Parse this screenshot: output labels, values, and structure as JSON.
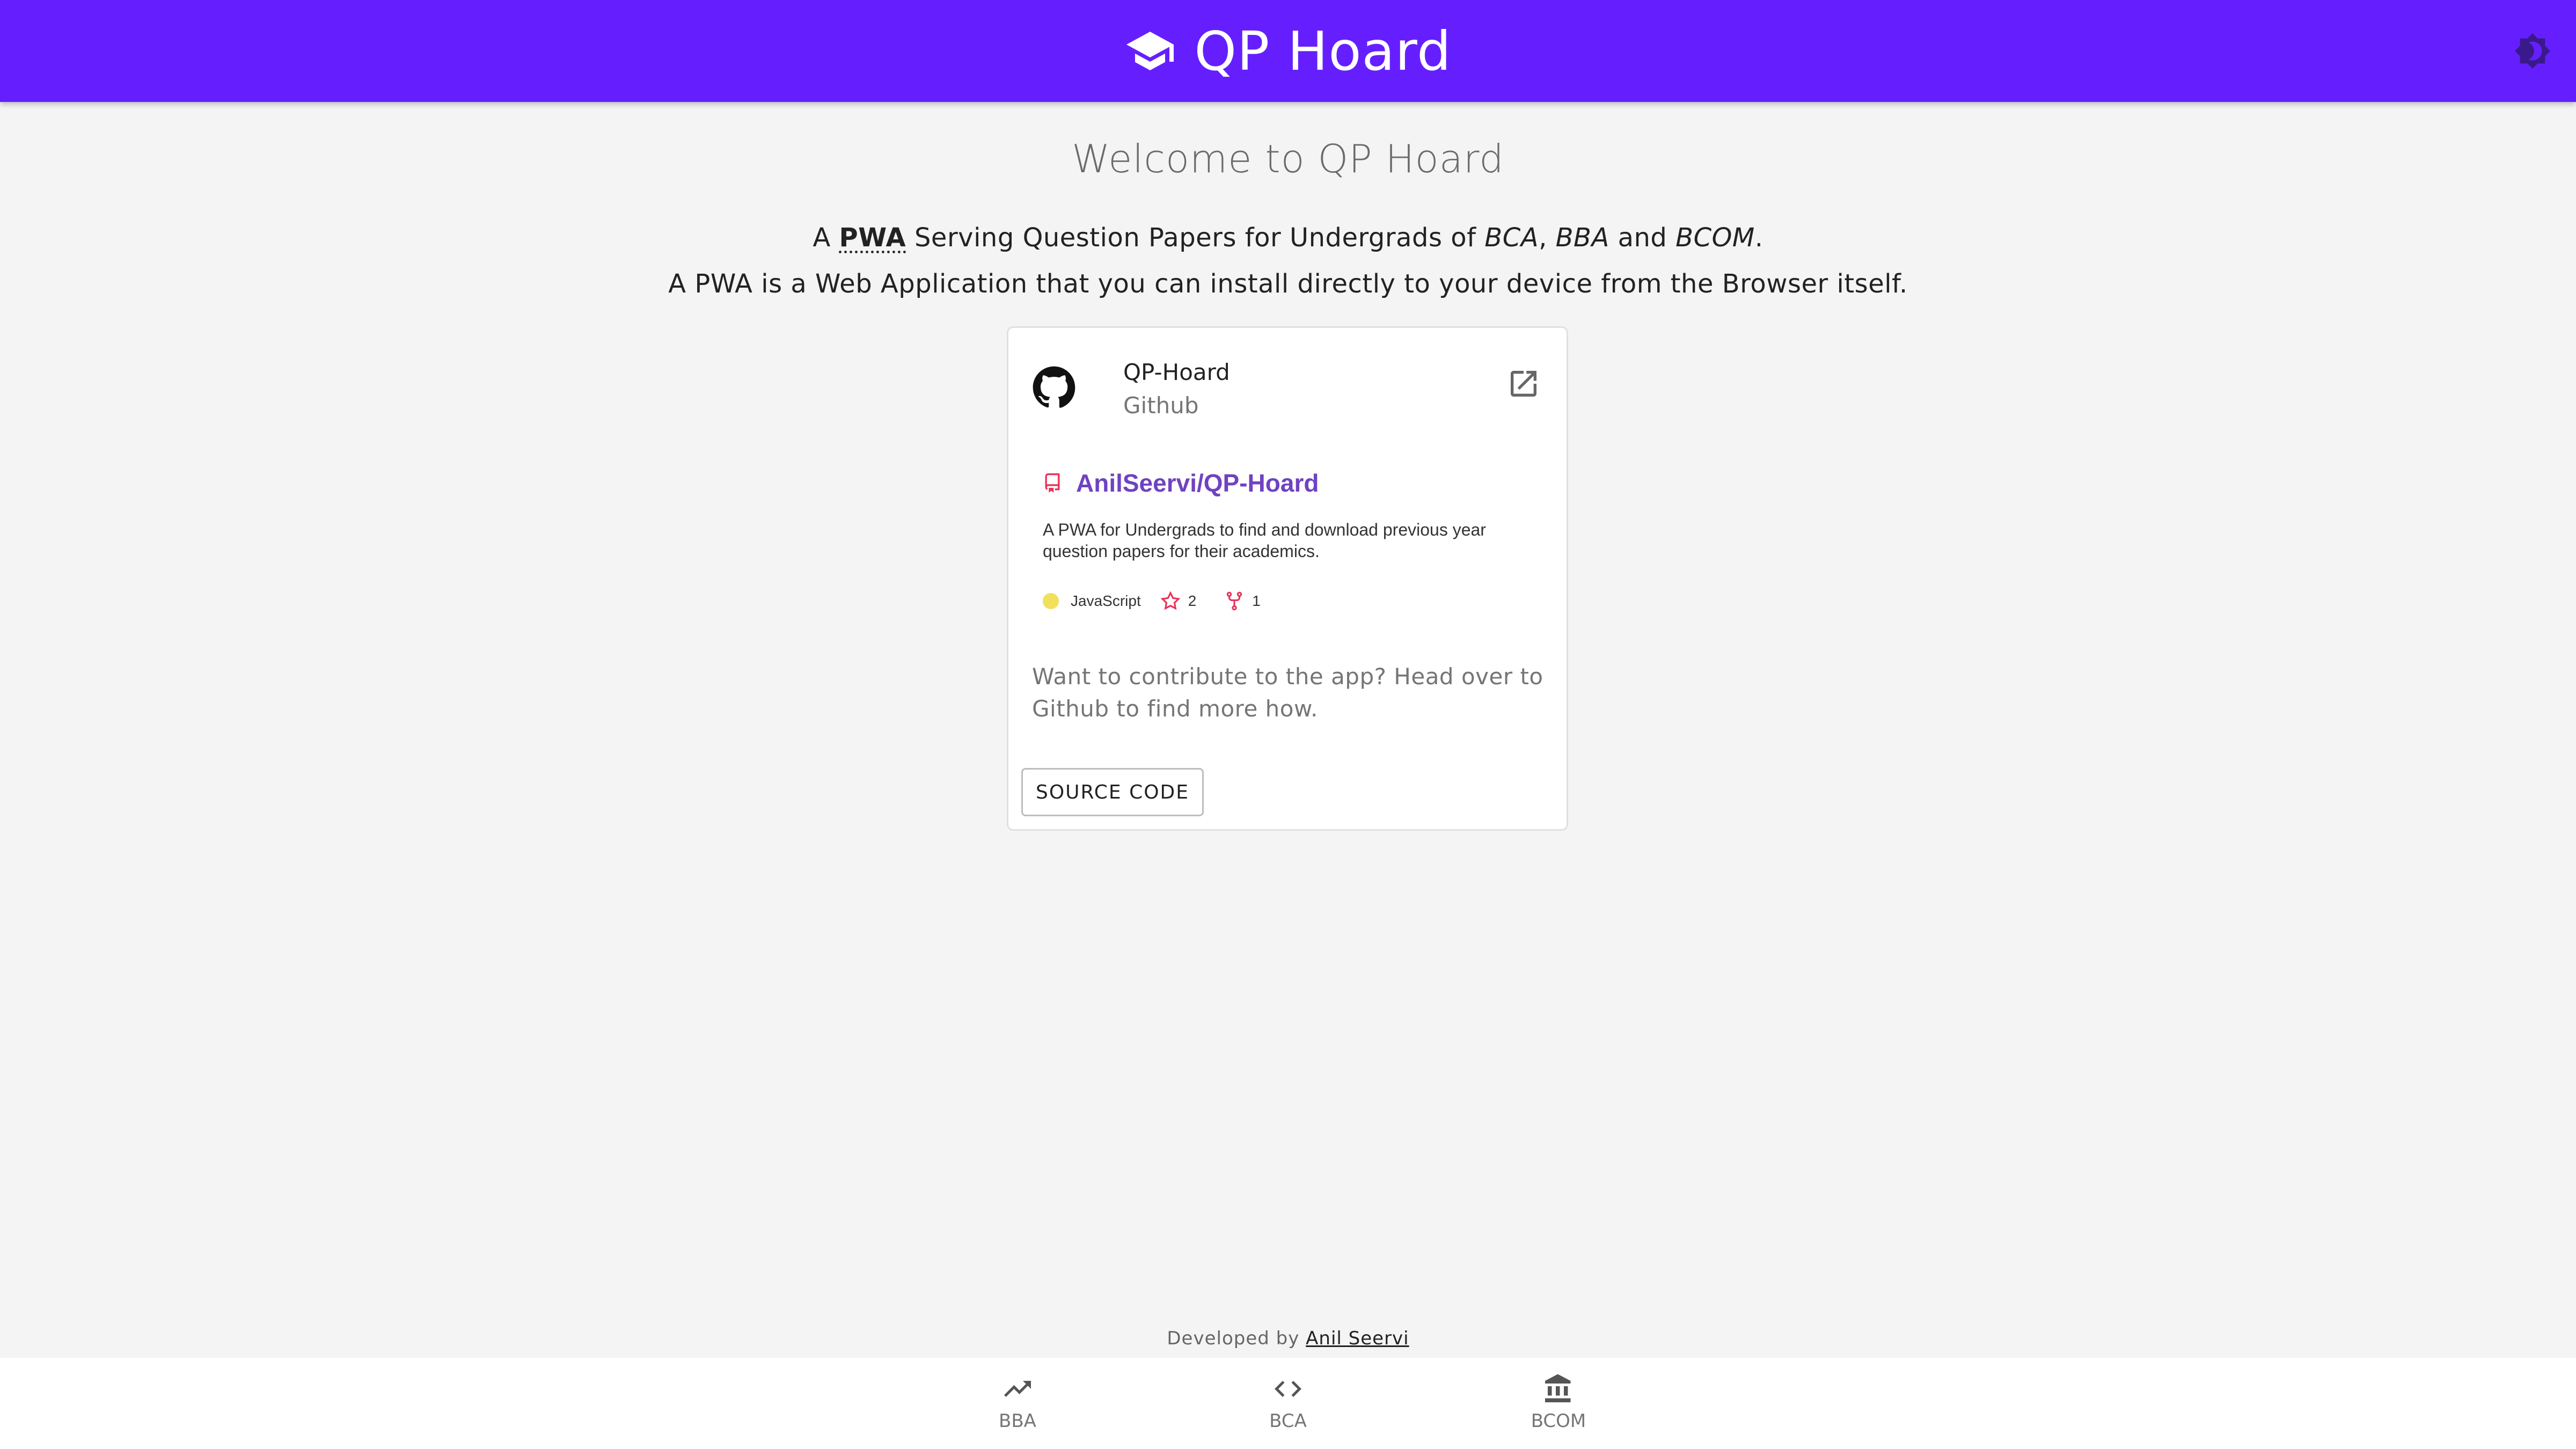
{
  "header": {
    "title": "QP Hoard",
    "logo_icon": "graduation-cap-icon",
    "theme_toggle_icon": "brightness-icon",
    "color": "#651fff"
  },
  "main": {
    "welcome": "Welcome to QP Hoard",
    "intro_line1": {
      "a": "A",
      "pwa": "PWA",
      "serving": "Serving Question Papers for Undergrads of",
      "bca": "BCA",
      "comma": ",",
      "bba": "BBA",
      "and": "and",
      "bcom": "BCOM",
      "period": "."
    },
    "intro_line2": "A PWA is a Web Application that you can install directly to your device from the Browser itself."
  },
  "card": {
    "title": "QP-Hoard",
    "subtitle": "Github",
    "avatar_icon": "github-icon",
    "open_icon": "open-in-new-icon",
    "repo": {
      "icon": "repo-icon",
      "name": "AnilSeervi/QP-Hoard",
      "description": "A PWA for Undergrads to find and download previous year question papers for their academics.",
      "language": "JavaScript",
      "language_color": "#f1e05a",
      "stars": "2",
      "forks": "1",
      "accent_color": "#e8335a"
    },
    "contribute_text": "Want to contribute to the app? Head over to Github to find more how.",
    "button_label": "SOURCE CODE"
  },
  "footer": {
    "developed_by": "Developed by",
    "author": "Anil Seervi"
  },
  "bottom_nav": [
    {
      "label": "BBA",
      "icon": "trending-up-icon"
    },
    {
      "label": "BCA",
      "icon": "code-icon"
    },
    {
      "label": "BCOM",
      "icon": "bank-icon"
    }
  ]
}
